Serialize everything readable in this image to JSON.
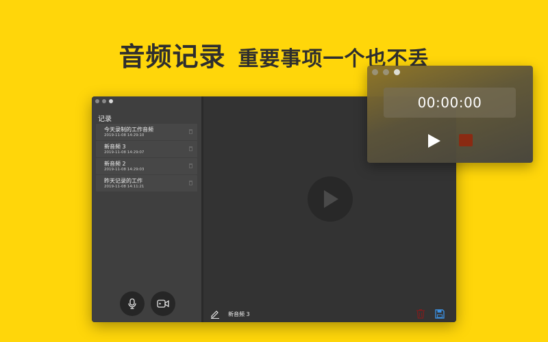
{
  "headline": {
    "primary": "音频记录",
    "secondary": "重要事项一个也不丢"
  },
  "main_window": {
    "sidebar": {
      "title": "记录",
      "items": [
        {
          "name": "今天录制的工作音频",
          "date": "2019-11-08 14:29:10"
        },
        {
          "name": "新音频 3",
          "date": "2019-11-08 14:29:07"
        },
        {
          "name": "新音频 2",
          "date": "2019-11-08 14:29:03"
        },
        {
          "name": "昨天记录的工作",
          "date": "2019-11-08 14:11:21"
        }
      ]
    },
    "bottom_bar": {
      "current_name": "新音频 3"
    }
  },
  "recorder": {
    "timer": "00:00:00"
  },
  "icons": {
    "mic": "microphone-icon",
    "camera": "video-camera-icon",
    "play": "play-icon",
    "edit": "pencil-icon",
    "trash": "trash-icon",
    "save": "floppy-disk-icon",
    "stop": "stop-icon"
  },
  "colors": {
    "background": "#FFD60A",
    "trash": "#7a1f1f",
    "save": "#3b8fe0",
    "stop": "#8a2a12"
  }
}
